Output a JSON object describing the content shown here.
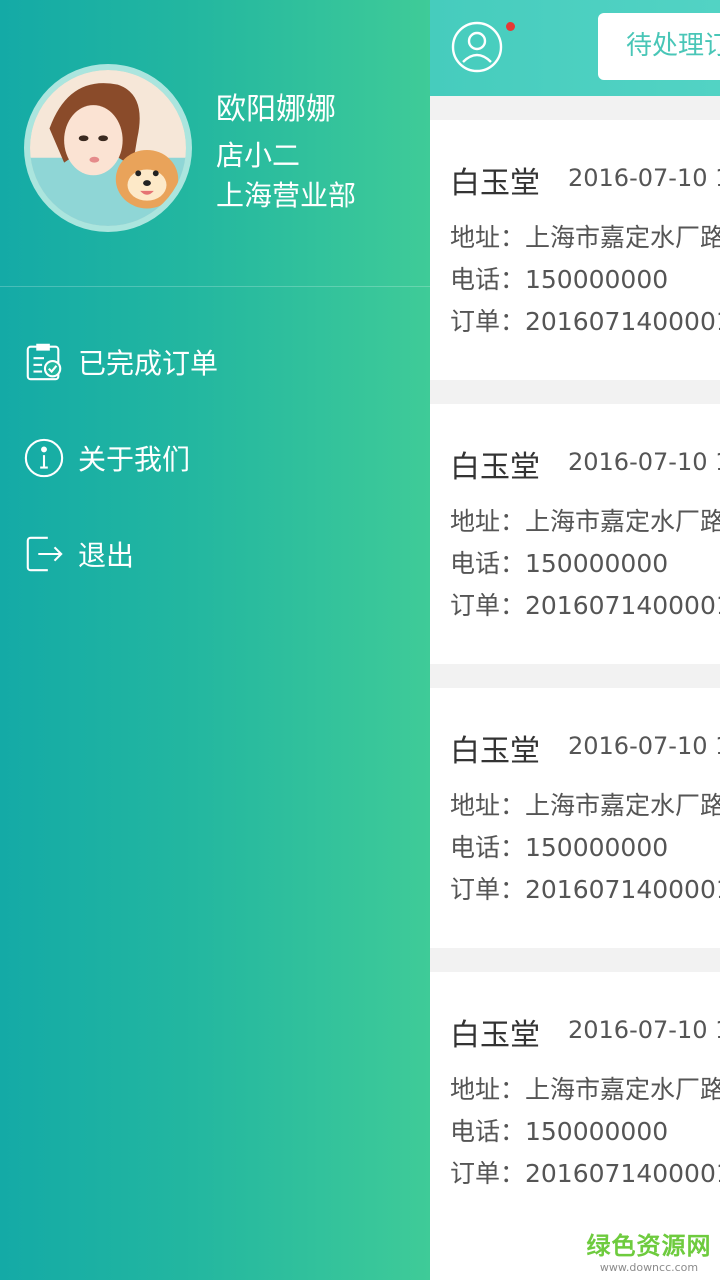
{
  "drawer": {
    "profile": {
      "name": "欧阳娜娜",
      "role": "店小二",
      "department": "上海营业部"
    },
    "menu": [
      {
        "label": "已完成订单",
        "icon": "clipboard-check-icon"
      },
      {
        "label": "关于我们",
        "icon": "info-icon"
      },
      {
        "label": "退出",
        "icon": "logout-icon"
      }
    ]
  },
  "header": {
    "user_icon": "user-icon",
    "tab_label": "待处理订"
  },
  "orders": [
    {
      "title": "白玉堂",
      "time": "2016-07-10 1",
      "address": "地址：上海市嘉定水厂路",
      "phone": "电话：150000000",
      "order": "订单：2016071400001"
    },
    {
      "title": "白玉堂",
      "time": "2016-07-10 1",
      "address": "地址：上海市嘉定水厂路",
      "phone": "电话：150000000",
      "order": "订单：2016071400001"
    },
    {
      "title": "白玉堂",
      "time": "2016-07-10 1",
      "address": "地址：上海市嘉定水厂路",
      "phone": "电话：150000000",
      "order": "订单：2016071400001"
    },
    {
      "title": "白玉堂",
      "time": "2016-07-10 1",
      "address": "地址：上海市嘉定水厂路",
      "phone": "电话：150000000",
      "order": "订单：2016071400001"
    }
  ],
  "watermark": {
    "name": "绿色资源网",
    "url": "www.downcc.com"
  },
  "colors": {
    "drawer_start": "#14aaa6",
    "drawer_end": "#3fcb98",
    "header": "#4ecfc0",
    "notification": "#e53935",
    "watermark": "#6ecb3e"
  }
}
